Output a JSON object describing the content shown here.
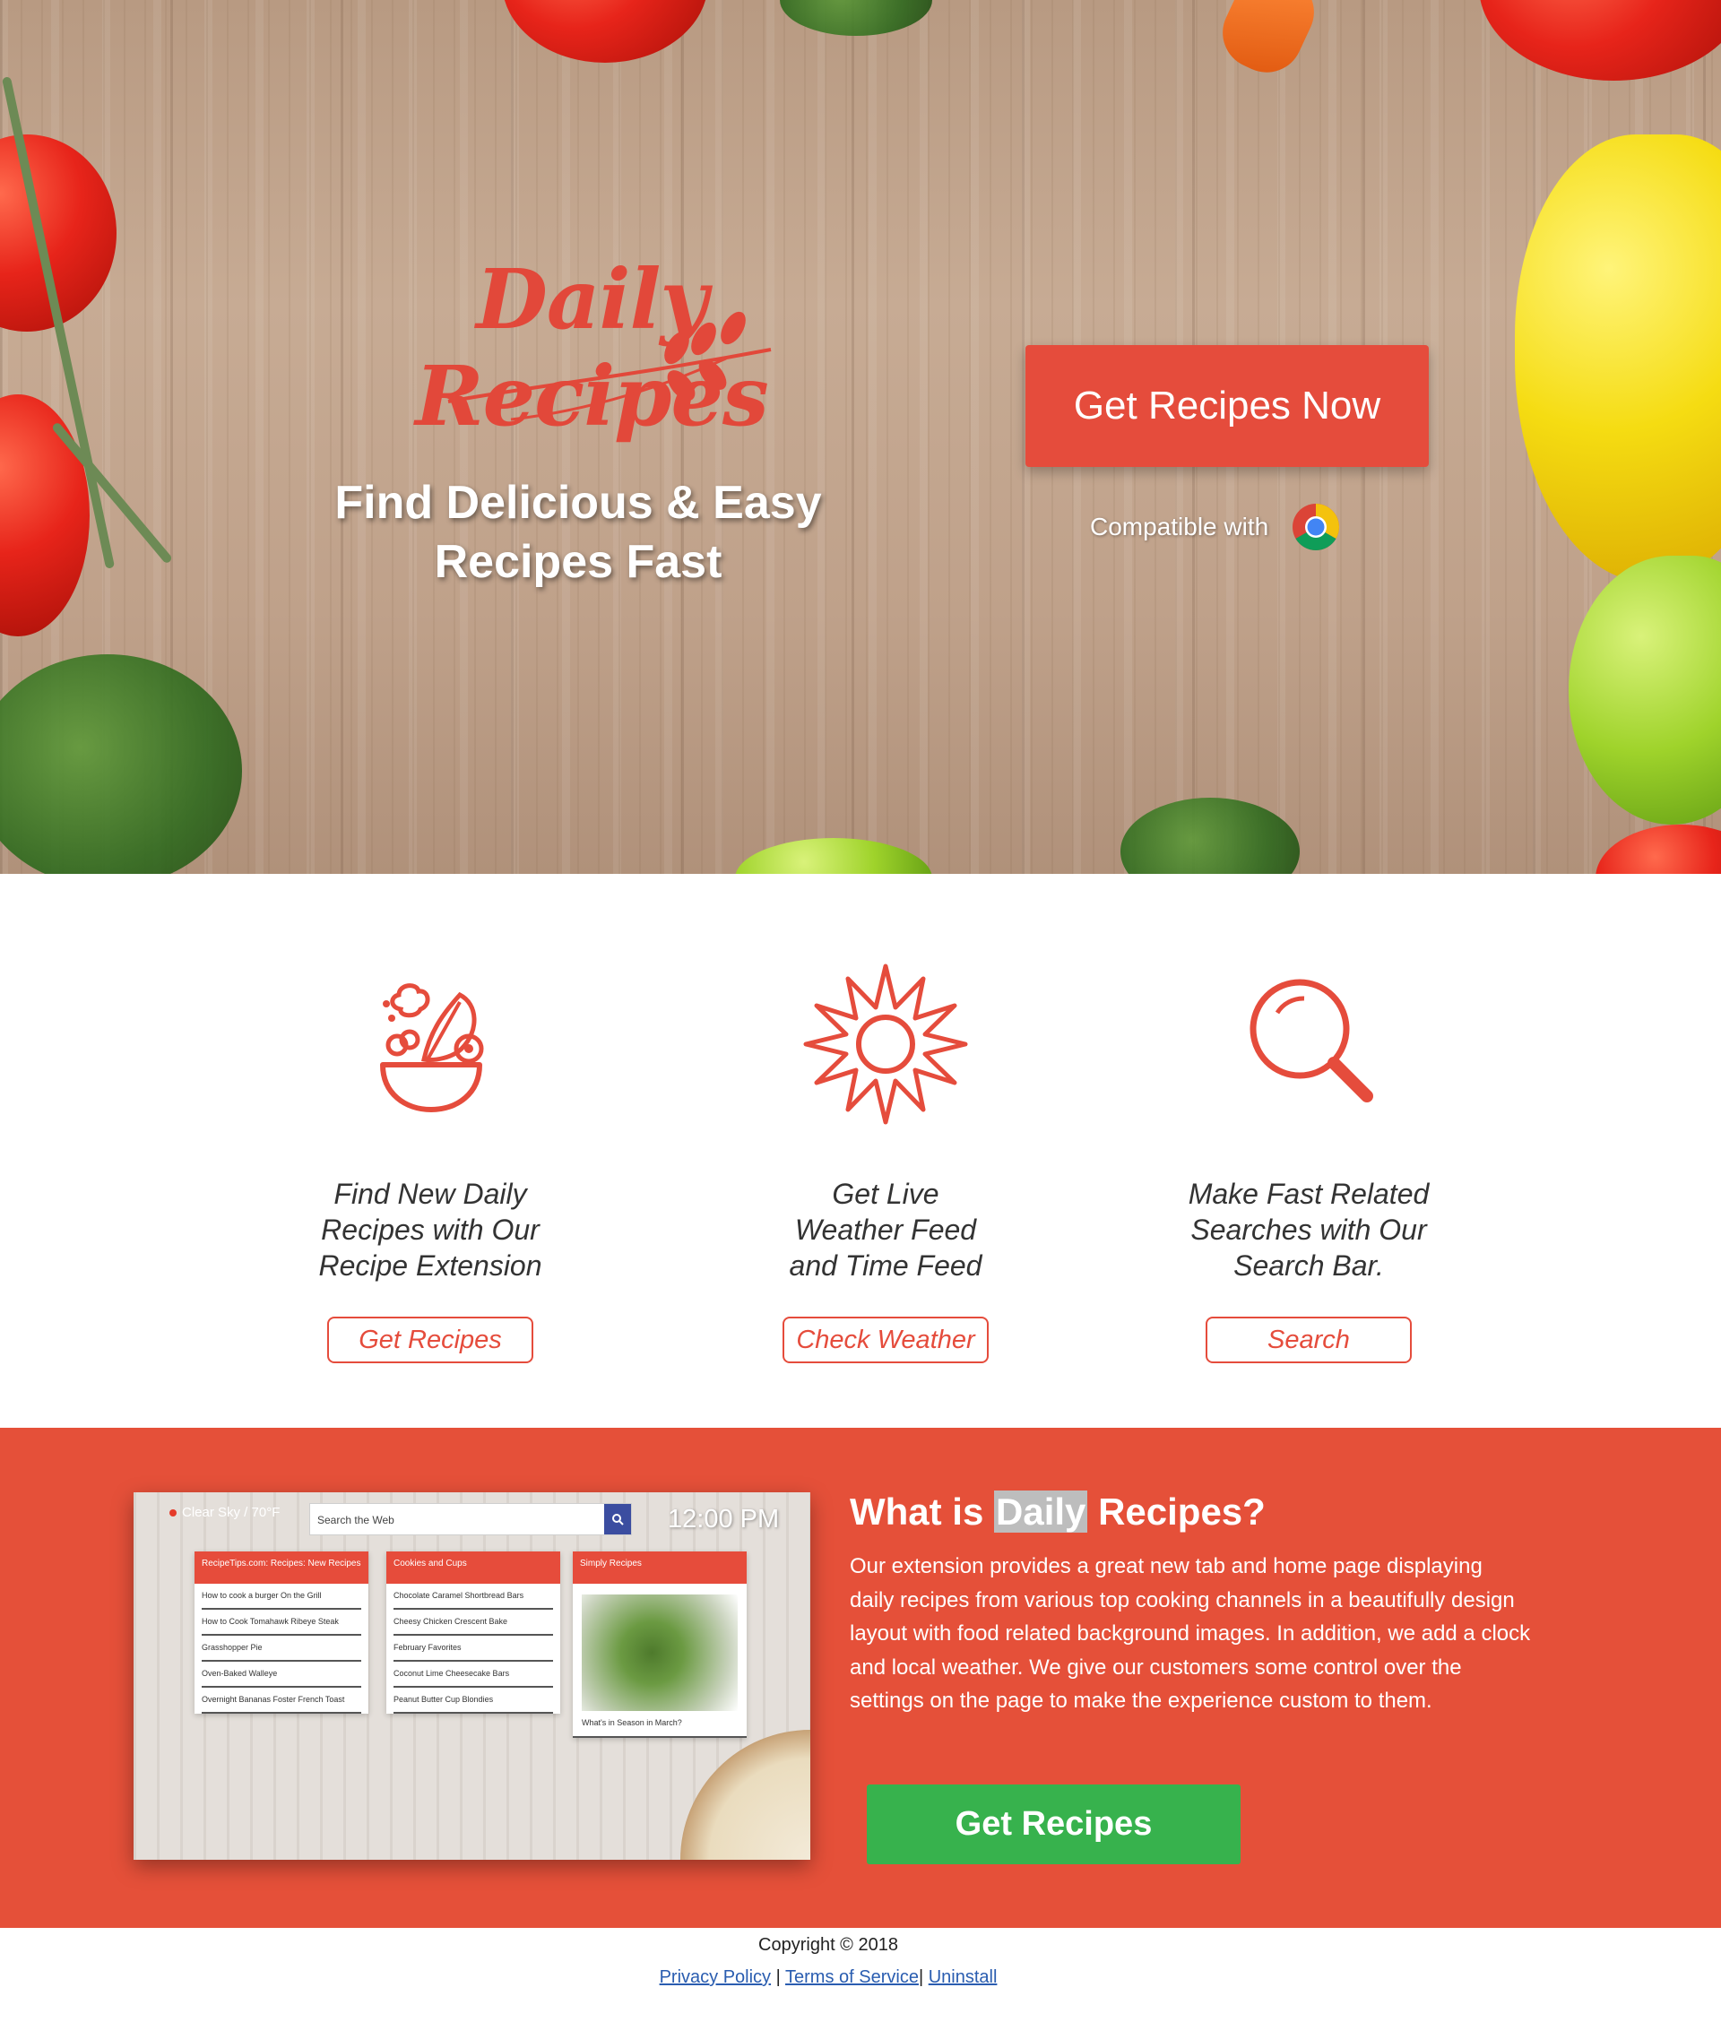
{
  "hero": {
    "logo_text": "Daily Recipes",
    "tagline_line1": "Find Delicious & Easy",
    "tagline_line2": "Recipes Fast",
    "cta_label": "Get Recipes Now",
    "compatible_label": "Compatible with",
    "browser_icon": "chrome-icon"
  },
  "features": [
    {
      "icon": "salad-bowl-icon",
      "line1": "Find New Daily",
      "line2": "Recipes with Our",
      "line3": "Recipe Extension",
      "button": "Get Recipes"
    },
    {
      "icon": "sun-icon",
      "line1": "Get Live",
      "line2": "Weather Feed",
      "line3": "and Time Feed",
      "button": "Check Weather"
    },
    {
      "icon": "magnifier-icon",
      "line1": "Make Fast Related",
      "line2": "Searches with Our",
      "line3": "Search Bar.",
      "button": "Search"
    }
  ],
  "about": {
    "title_pre": "What is ",
    "title_highlight": "Daily",
    "title_post": " Recipes?",
    "body": "Our extension provides a great new tab and home page displaying daily recipes from various top cooking channels in a beautifully design layout with food related background images. In addition, we add a clock and local weather. We give our customers some control over the settings on the page to make the experience custom to them.",
    "cta_label": "Get Recipes",
    "screenshot": {
      "weather": "Clear Sky / 70°F",
      "search_placeholder": "Search the Web",
      "clock": "12:00 PM",
      "cards": [
        {
          "title": "RecipeTips.com: Recipes: New Recipes",
          "items": [
            "How to cook a burger On the Grill",
            "How to Cook Tomahawk Ribeye Steak",
            "Grasshopper Pie",
            "Oven-Baked Walleye",
            "Overnight Bananas Foster French Toast"
          ]
        },
        {
          "title": "Cookies and Cups",
          "items": [
            "Chocolate Caramel Shortbread Bars",
            "Cheesy Chicken Crescent Bake",
            "February Favorites",
            "Coconut Lime Cheesecake Bars",
            "Peanut Butter Cup Blondies"
          ]
        },
        {
          "title": "Simply Recipes",
          "caption": "What's in Season in March?"
        }
      ]
    }
  },
  "footer": {
    "copyright": "Copyright © 2018",
    "privacy": "Privacy Policy",
    "sep1": " | ",
    "terms": "Terms of Service",
    "sep2": "| ",
    "uninstall": "Uninstall"
  },
  "colors": {
    "brand_red": "#e54c3c",
    "about_bg": "#e55039",
    "cta_green": "#37b24d",
    "link_blue": "#2a5db0"
  }
}
